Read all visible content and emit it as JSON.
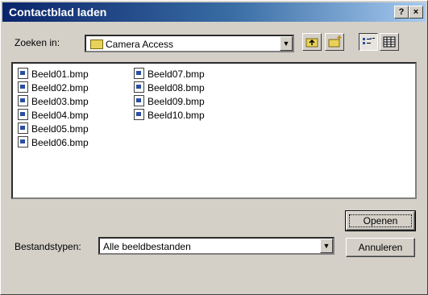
{
  "window": {
    "title": "Contactblad laden",
    "help_glyph": "?",
    "close_glyph": "×"
  },
  "lookin": {
    "label": "Zoeken in:",
    "value": "Camera Access"
  },
  "toolbar": {
    "icons": [
      "up-folder-icon",
      "new-folder-icon",
      "list-view-icon",
      "details-view-icon"
    ]
  },
  "files": [
    "Beeld01.bmp",
    "Beeld02.bmp",
    "Beeld03.bmp",
    "Beeld04.bmp",
    "Beeld05.bmp",
    "Beeld06.bmp",
    "Beeld07.bmp",
    "Beeld08.bmp",
    "Beeld09.bmp",
    "Beeld10.bmp"
  ],
  "filetype": {
    "label": "Bestandstypen:",
    "value": "Alle beeldbestanden"
  },
  "buttons": {
    "open": "Openen",
    "cancel": "Annuleren"
  },
  "colors": {
    "title_bar": "#0a246a",
    "face": "#d4d0c8"
  }
}
